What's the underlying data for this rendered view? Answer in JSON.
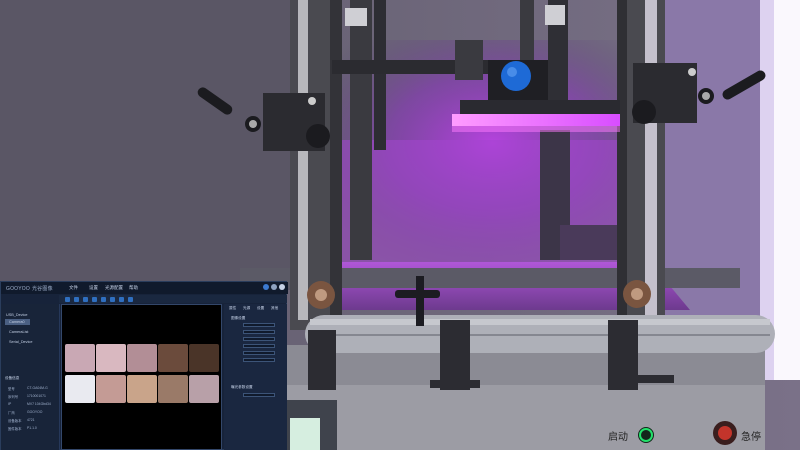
{
  "app": {
    "logo": "GOOYOO",
    "logo_sub": "光谷图像",
    "menu": [
      "文件",
      "设置",
      "光源配置",
      "帮助"
    ]
  },
  "sidebar": {
    "items": [
      "USB_Device",
      "Camera0",
      "CameraList",
      "Serial_Device"
    ],
    "section_title": "设备信息",
    "info": [
      {
        "label": "型号",
        "value": "CT-GA04M-G"
      },
      {
        "label": "序列号",
        "value": "1710001071"
      },
      {
        "label": "IP",
        "value": "MV7 104Gbd34"
      },
      {
        "label": "厂商",
        "value": "GOOYOO"
      },
      {
        "label": "设备版本",
        "value": "4721"
      },
      {
        "label": "固件版本",
        "value": "P1.1.0"
      }
    ]
  },
  "right_panel": {
    "tabs": [
      "属性",
      "光源",
      "设置",
      "其他"
    ],
    "section1": "图像设置",
    "section2": "曝光参数设置"
  },
  "machine": {
    "start_label": "启动",
    "stop_label": "急停"
  },
  "colors": {
    "uv_light": "#d24dff",
    "ui_bg": "#17233a",
    "accent": "#2f6fc0"
  },
  "samples": {
    "row1": [
      "#c9a8b4",
      "#d9b8c0",
      "#b28e96",
      "#6b4b3c",
      "#4a3428"
    ],
    "row2": [
      "#e9eaf0",
      "#c49b95",
      "#c9a48a",
      "#9a7a68",
      "#b8a0a8"
    ]
  }
}
